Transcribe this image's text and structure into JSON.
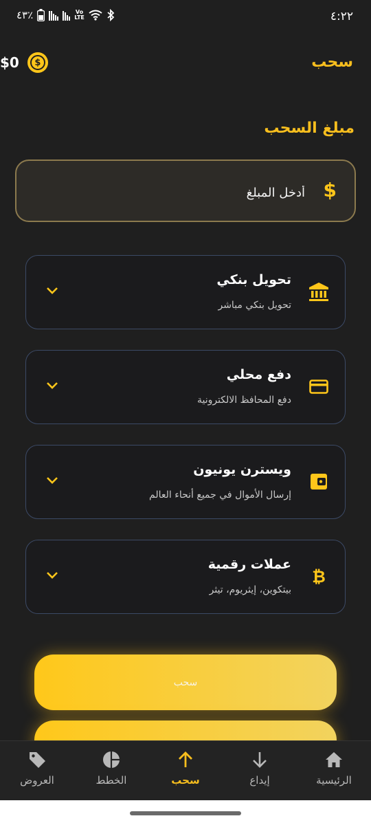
{
  "status_bar": {
    "time": "٤:٢٢",
    "battery": "٤٣٪"
  },
  "header": {
    "title": "سحب",
    "balance": "$0",
    "balance_icon": "dollar-coin-icon"
  },
  "amount": {
    "section_title": "مبلغ السحب",
    "placeholder": "أدخل المبلغ",
    "value": "",
    "icon": "dollar-icon"
  },
  "methods": [
    {
      "title": "تحويل بنكي",
      "subtitle": "تحويل بنكي مباشر",
      "icon": "bank-icon"
    },
    {
      "title": "دفع محلي",
      "subtitle": "دفع المحافظ الالكترونية",
      "icon": "credit-card-icon"
    },
    {
      "title": "ويسترن يونيون",
      "subtitle": "إرسال الأموال في جميع أنحاء العالم",
      "icon": "wallet-icon"
    },
    {
      "title": "عملات رقمية",
      "subtitle": "بيتكوين، إيثريوم، تيثر",
      "icon": "bitcoin-icon"
    }
  ],
  "actions": {
    "withdraw_label": "سحب"
  },
  "bottom_nav": {
    "items": [
      {
        "label": "الرئيسية",
        "icon": "home-icon"
      },
      {
        "label": "إيداع",
        "icon": "arrow-down-icon"
      },
      {
        "label": "سحب",
        "icon": "arrow-up-icon",
        "active": true
      },
      {
        "label": "الخطط",
        "icon": "pie-chart-icon"
      },
      {
        "label": "العروض",
        "icon": "tag-icon"
      }
    ]
  },
  "colors": {
    "accent": "#f7be1e",
    "background": "#1f1f1f",
    "card_border": "#3c4a66"
  }
}
